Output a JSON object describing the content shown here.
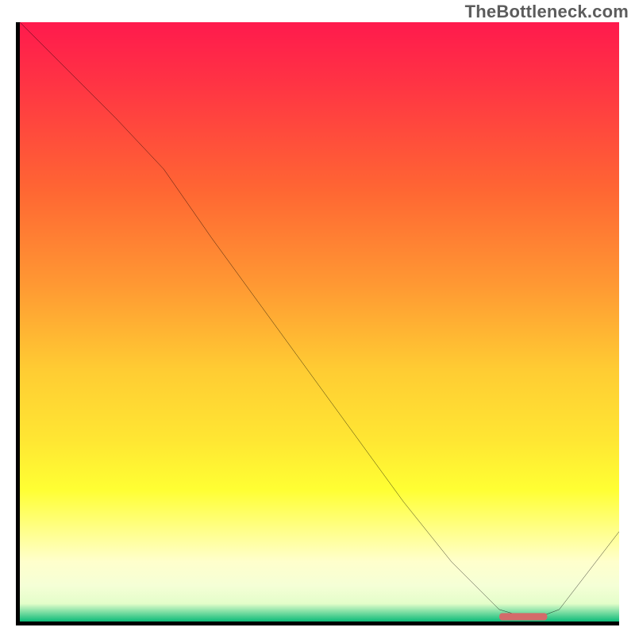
{
  "watermark": "TheBottleneck.com",
  "colors": {
    "border": "#000000",
    "line": "#000000",
    "marker": "#d46a6a",
    "gradient_top": "#ff1a4d",
    "gradient_bottom": "#0dbb79"
  },
  "chart_data": {
    "type": "line",
    "title": "",
    "xlabel": "",
    "ylabel": "",
    "xlim": [
      0,
      100
    ],
    "ylim": [
      0,
      100
    ],
    "series": [
      {
        "name": "curve",
        "x": [
          0,
          8,
          16,
          24,
          32,
          40,
          48,
          56,
          64,
          72,
          80,
          84,
          86,
          90,
          100
        ],
        "values": [
          100,
          92,
          84,
          75.5,
          64,
          53,
          42,
          31,
          20,
          10,
          2,
          0.8,
          0.5,
          2,
          15
        ]
      }
    ],
    "marker": {
      "x": [
        80,
        88
      ],
      "y": 0.8
    },
    "gradient_stops": [
      {
        "pos": 0,
        "color": "#ff1a4d"
      },
      {
        "pos": 10,
        "color": "#ff3344"
      },
      {
        "pos": 28,
        "color": "#ff6633"
      },
      {
        "pos": 44,
        "color": "#ff9933"
      },
      {
        "pos": 58,
        "color": "#ffcc33"
      },
      {
        "pos": 70,
        "color": "#ffe733"
      },
      {
        "pos": 78,
        "color": "#ffff33"
      },
      {
        "pos": 86,
        "color": "#ffff99"
      },
      {
        "pos": 90,
        "color": "#ffffcc"
      },
      {
        "pos": 94,
        "color": "#f5ffd6"
      },
      {
        "pos": 97,
        "color": "#e4feca"
      },
      {
        "pos": 100,
        "color": "#0dbb79"
      }
    ]
  }
}
